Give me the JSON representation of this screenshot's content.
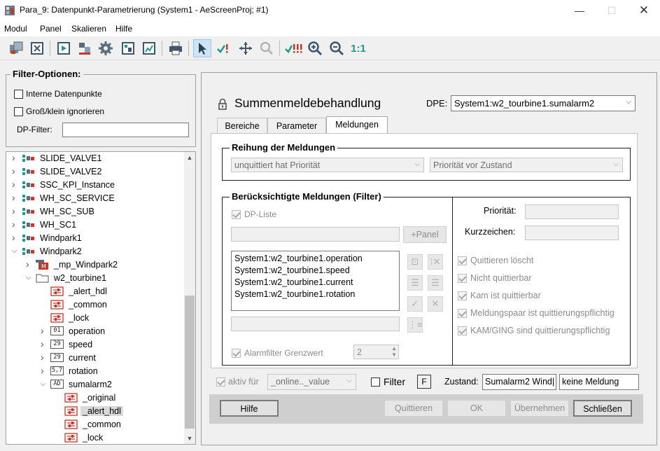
{
  "window": {
    "title": "Para_9: Datenpunkt-Parametrierung (System1 - AeScreenProj; #1)"
  },
  "menu": [
    "Modul",
    "Panel",
    "Skalieren",
    "Hilfe"
  ],
  "toolbar": {
    "zoom_reset": "1:1"
  },
  "filter": {
    "title": "Filter-Optionen:",
    "internal_dp": "Interne Datenpunkte",
    "case_ignore": "Groß/klein ignorieren",
    "dp_filter_label": "DP-Filter:",
    "dp_filter_value": ""
  },
  "tree": [
    {
      "label": "SLIDE_VALVE1",
      "type": "dpt",
      "level": 0,
      "state": "collapsed"
    },
    {
      "label": "SLIDE_VALVE2",
      "type": "dpt",
      "level": 0,
      "state": "collapsed"
    },
    {
      "label": "SSC_KPI_Instance",
      "type": "dpt",
      "level": 0,
      "state": "collapsed"
    },
    {
      "label": "WH_SC_SERVICE",
      "type": "dpt",
      "level": 0,
      "state": "collapsed"
    },
    {
      "label": "WH_SC_SUB",
      "type": "dpt",
      "level": 0,
      "state": "collapsed"
    },
    {
      "label": "WH_SC1",
      "type": "dpt",
      "level": 0,
      "state": "collapsed"
    },
    {
      "label": "Windpark1",
      "type": "dpt",
      "level": 0,
      "state": "collapsed"
    },
    {
      "label": "Windpark2",
      "type": "dpt",
      "level": 0,
      "state": "expanded"
    },
    {
      "label": "_mp_Windpark2",
      "type": "master",
      "level": 1,
      "state": "collapsed"
    },
    {
      "label": "w2_tourbine1",
      "type": "folder",
      "level": 1,
      "state": "expanded"
    },
    {
      "label": "_alert_hdl",
      "type": "config",
      "level": 2,
      "state": "none"
    },
    {
      "label": "_common",
      "type": "config",
      "level": 2,
      "state": "none"
    },
    {
      "label": "_lock",
      "type": "config",
      "level": 2,
      "state": "none"
    },
    {
      "label": "operation",
      "type": "01",
      "level": 2,
      "state": "collapsed"
    },
    {
      "label": "speed",
      "type": "29",
      "level": 2,
      "state": "collapsed"
    },
    {
      "label": "current",
      "type": "29",
      "level": 2,
      "state": "collapsed"
    },
    {
      "label": "rotation",
      "type": "5,7",
      "level": 2,
      "state": "collapsed"
    },
    {
      "label": "sumalarm2",
      "type": "AD",
      "level": 2,
      "state": "expanded"
    },
    {
      "label": "_original",
      "type": "config",
      "level": 3,
      "state": "none"
    },
    {
      "label": "_alert_hdl",
      "type": "config",
      "level": 3,
      "state": "none",
      "selected": true
    },
    {
      "label": "_common",
      "type": "config",
      "level": 3,
      "state": "none"
    },
    {
      "label": "_lock",
      "type": "config",
      "level": 3,
      "state": "none"
    }
  ],
  "main": {
    "title": "Summenmeldebehandlung",
    "dpe_label": "DPE:",
    "dpe_value": "System1:w2_tourbine1.sumalarm2",
    "tabs": [
      "Bereiche",
      "Parameter",
      "Meldungen"
    ],
    "active_tab": "Meldungen",
    "order_group": {
      "title": "Reihung der Meldungen",
      "combo1": "unquittiert hat Priorität",
      "combo2": "Priorität vor Zustand"
    },
    "filter_group": {
      "title": "Berücksichtigte Meldungen (Filter)",
      "dp_list": "DP-Liste",
      "panel_button": "+Panel",
      "list": [
        "System1:w2_tourbine1.operation",
        "System1:w2_tourbine1.speed",
        "System1:w2_tourbine1.current",
        "System1:w2_tourbine1.rotation"
      ],
      "alarm_filter": "Alarmfilter Grenzwert",
      "alarm_filter_value": "2"
    },
    "right_group": {
      "priority_label": "Priorität:",
      "shortsign_label": "Kurzzeichen:",
      "checks": [
        "Quittieren löscht",
        "Nicht quittierbar",
        "Kam ist quittierbar",
        "Meldungspaar ist quittierungspflichtig",
        "KAM/GING sind quittierungspflichtig"
      ]
    },
    "active_for": "aktiv für",
    "active_for_value": "_online.._value",
    "filter_label": "Filter",
    "f_box": "F",
    "state_label": "Zustand:",
    "state_value1": "Sumalarm2 Wind|",
    "state_value2": "keine Meldung",
    "buttons": {
      "help": "Hilfe",
      "ack": "Quittieren",
      "ok": "OK",
      "apply": "Übernehmen",
      "close": "Schließen"
    }
  }
}
